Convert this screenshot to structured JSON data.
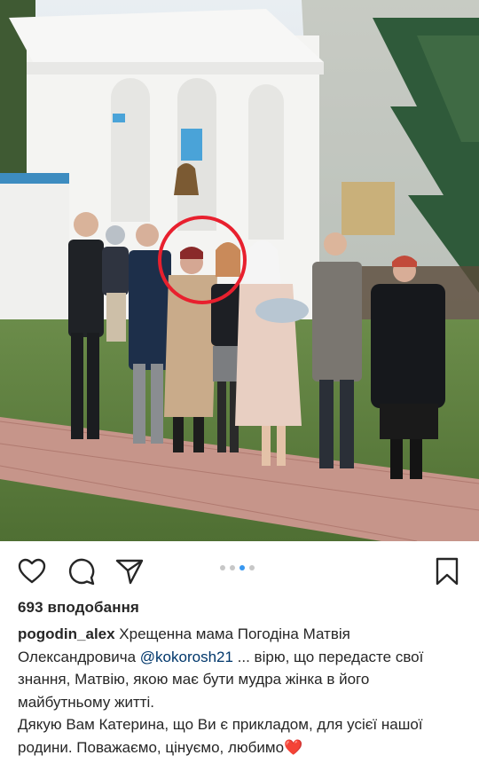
{
  "post": {
    "image_alt": "",
    "carousel": {
      "count": 4,
      "active_index": 3
    },
    "likes_text": "693 вподобання",
    "caption": {
      "username": "pogodin_alex",
      "text_part1": " Хрещенна мама Погодіна Матвія Олександровича ",
      "mention": "@kokorosh21",
      "text_part2": " ... вірю, що передасте свої знання, Матвію, якою має бути мудра жінка в його майбутньому житті.",
      "line2": "Дякую Вам Катерина, що Ви є прикладом, для усієї нашої родини. Поважаємо, цінуємо, любимо",
      "emoji": "❤️"
    }
  },
  "icons": {
    "like": "heart-outline-icon",
    "comment": "comment-bubble-icon",
    "share": "paper-plane-icon",
    "save": "bookmark-icon"
  },
  "colors": {
    "accent_dot": "#3897f0",
    "highlight_circle": "#e8202e",
    "mention": "#00376b",
    "heart_emoji": "#e0245e"
  }
}
